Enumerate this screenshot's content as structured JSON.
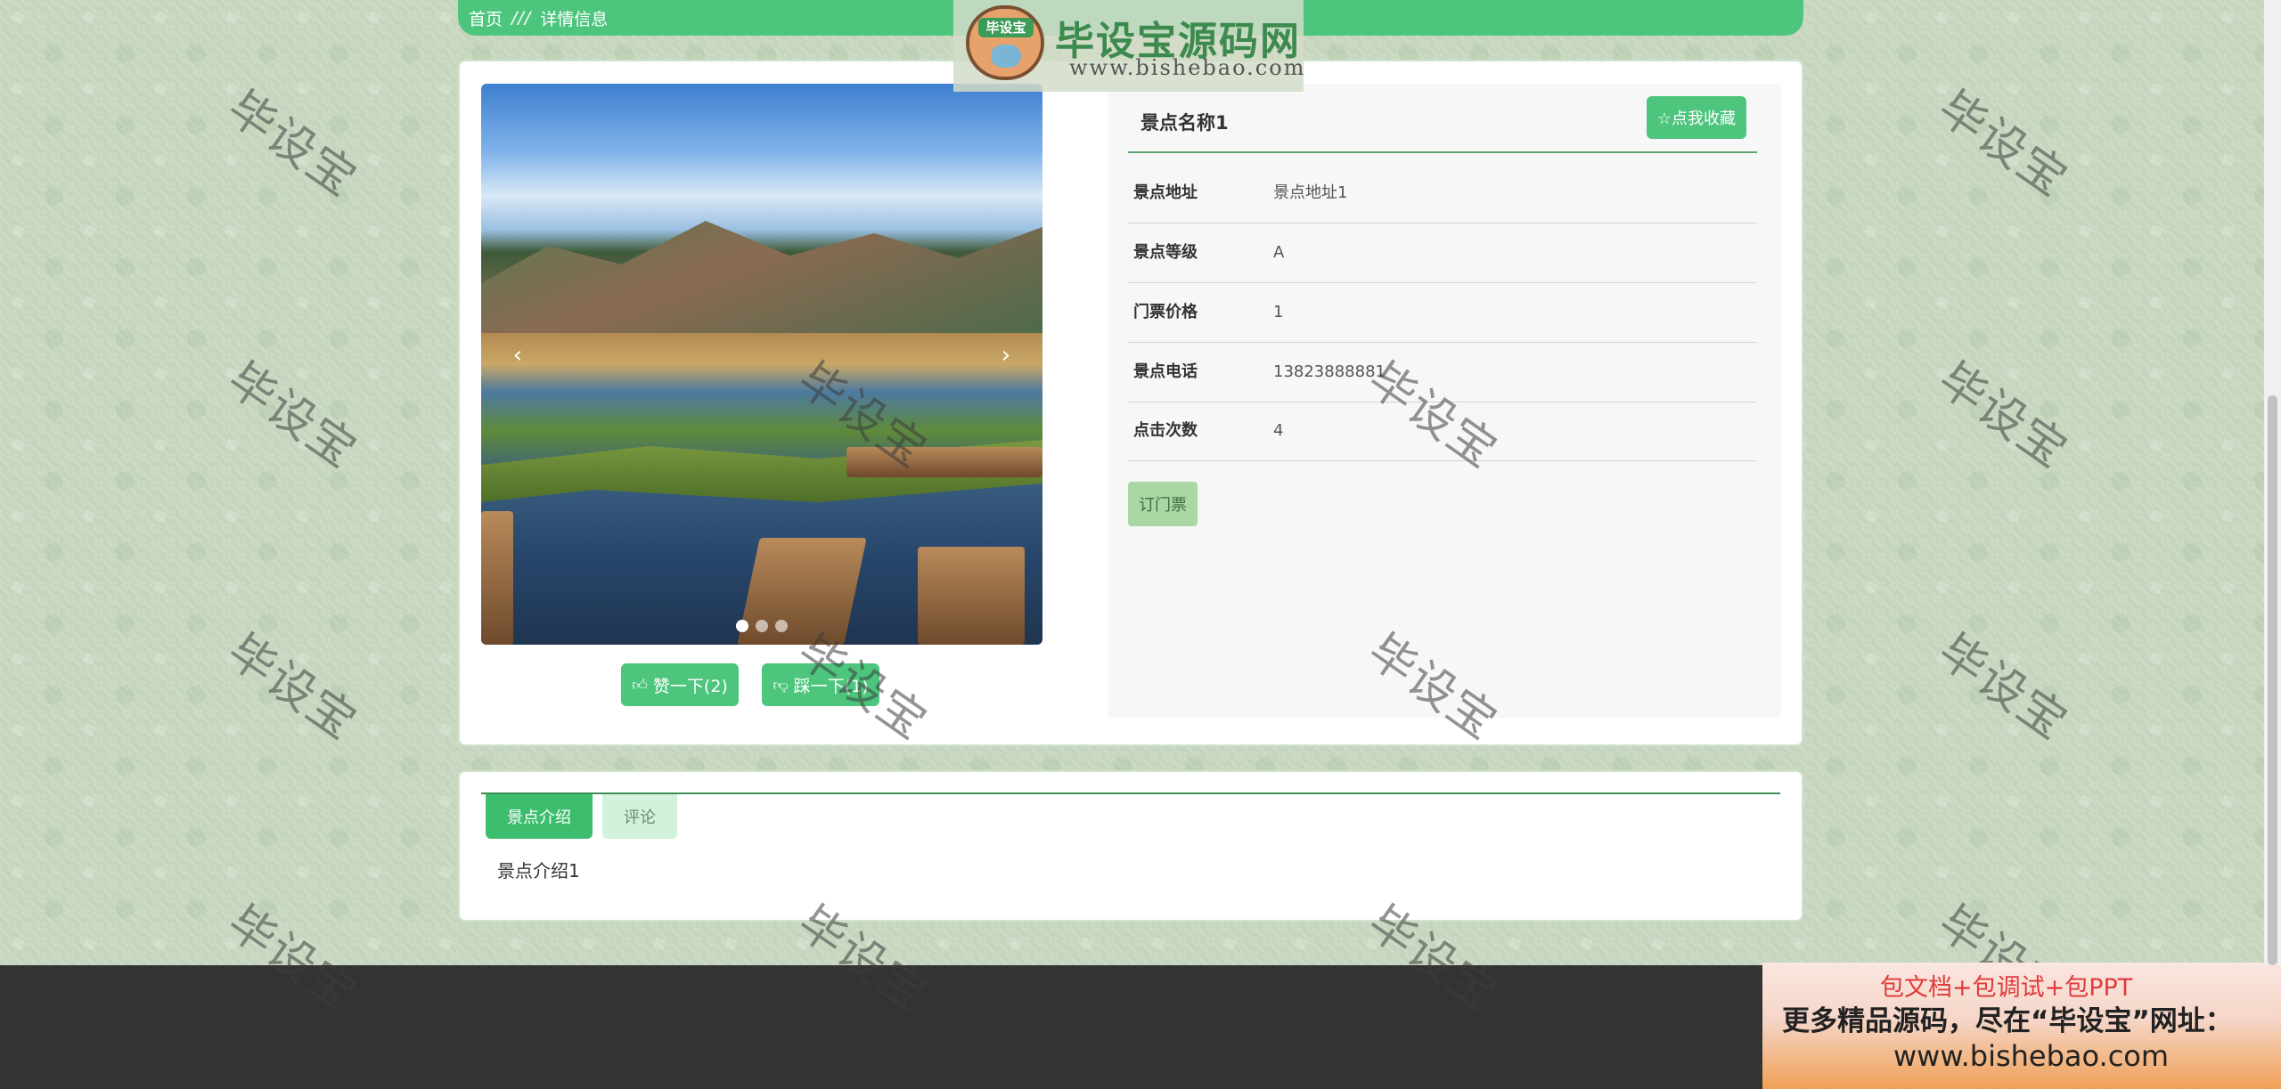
{
  "breadcrumb": {
    "home": "首页",
    "separator": "///",
    "current": "详情信息"
  },
  "logo": {
    "badge": "毕设宝",
    "title": "毕设宝源码网",
    "url": "www.bishebao.com"
  },
  "carousel": {
    "prev_arrow": "‹",
    "next_arrow": "›",
    "slide_count": 3,
    "active_index": 0
  },
  "votes": {
    "like": {
      "icon": "thumbs-up-icon",
      "label": "赞一下(2)"
    },
    "dislike": {
      "icon": "thumbs-down-icon",
      "label": "踩一下(1)"
    }
  },
  "detail": {
    "name": "景点名称1",
    "favorite_label": "☆点我收藏",
    "fields": [
      {
        "label": "景点地址",
        "value": "景点地址1"
      },
      {
        "label": "景点等级",
        "value": "A"
      },
      {
        "label": "门票价格",
        "value": "1"
      },
      {
        "label": "景点电话",
        "value": "13823888881"
      },
      {
        "label": "点击次数",
        "value": "4"
      }
    ],
    "ticket_button": "订门票"
  },
  "tabs": [
    {
      "label": "景点介绍",
      "active": true
    },
    {
      "label": "评论",
      "active": false
    }
  ],
  "intro_content": "景点介绍1",
  "watermark": "毕设宝",
  "promo": {
    "line1": "包文档+包调试+包PPT",
    "line2": "更多精品源码，尽在“毕设宝”网址：",
    "line3": "www.bishebao.com"
  },
  "colors": {
    "accent": "#4dc57d",
    "footer": "#333333",
    "tab_line": "#3f8f55"
  }
}
